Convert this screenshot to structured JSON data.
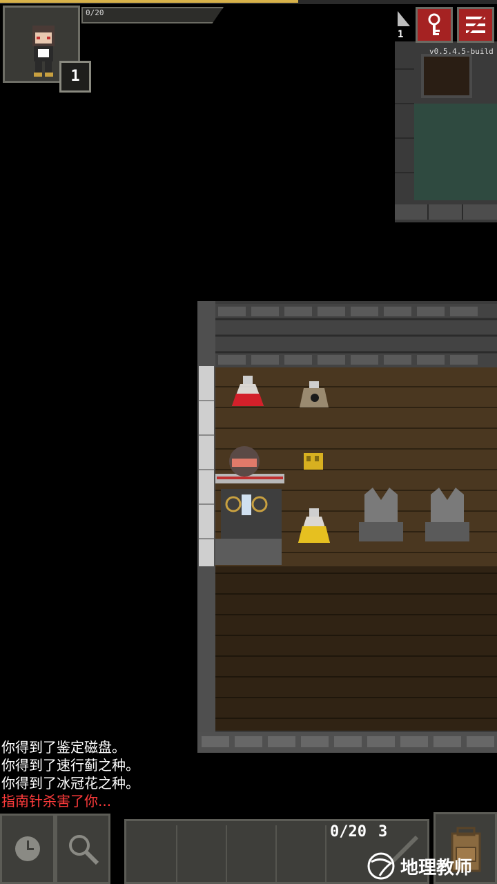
{
  "status": {
    "xp_progress": 0.6,
    "hp_text": "0/20",
    "level": "1",
    "depth": "1",
    "version": "v0.5.4.5-build"
  },
  "buttons": {
    "journal_icon": "key-icon",
    "menu_icon": "menu-icon",
    "wait_icon": "clock-icon",
    "search_icon": "magnifier-icon",
    "inventory_icon": "backpack-icon"
  },
  "log": {
    "lines": [
      "你得到了鉴定磁盘。",
      "你得到了速行蓟之种。",
      "你得到了冰冠花之种。",
      "指南针杀害了你..."
    ]
  },
  "quickslot": {
    "ammo_count": "0/20",
    "charges": "3"
  },
  "watermark": {
    "text": "地理教师"
  },
  "colors": {
    "accent_red": "#a52222",
    "death_text": "#ff3b3b",
    "xp_gold": "#d8b24a",
    "floor_wood": "#4a3720",
    "wall_stone": "#5a5a5a"
  }
}
